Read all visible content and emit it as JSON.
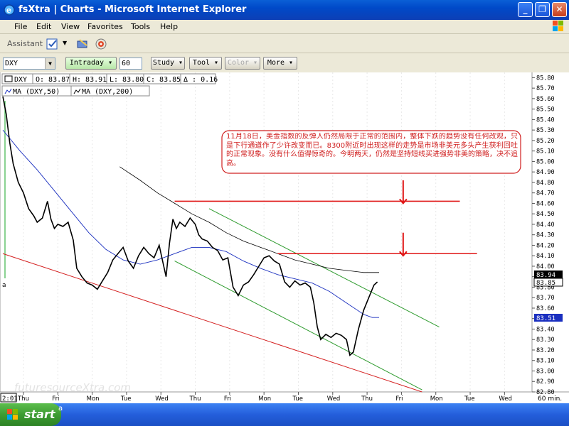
{
  "window": {
    "title": "fsXtra  |  Charts - Microsoft Internet Explorer",
    "controls": {
      "minimize": "_",
      "maximize": "❐",
      "close": "✕"
    }
  },
  "menu": [
    "File",
    "Edit",
    "View",
    "Favorites",
    "Tools",
    "Help"
  ],
  "toolbar": {
    "assistant_label": "Assistant"
  },
  "chart_toolbar": {
    "symbol": "DXY",
    "period_mode": "Intraday",
    "interval": "60",
    "buttons": [
      "Study",
      "Tool",
      "Color",
      "More"
    ]
  },
  "legend": {
    "ohlc": {
      "symbol": "DXY",
      "open": "O: 83.87",
      "high": "H: 83.91",
      "low": "L: 83.80",
      "close": "C: 83.85",
      "delta": "Δ : 0.16"
    },
    "ma50": "MA (DXY,50)",
    "ma200": "MA (DXY,200)"
  },
  "annotation": "11月18日，美金指数的反弹人仍然局限于正常的范围内，整体下跌的趋势没有任何改观，只是下行通道作了少许改变而已。8300附近时出现这样的走势是市场非美元多头产生获利回吐的正常现象。没有什么值得惊奇的。今明两天，仍然是坚持短线买进强势非美的策略，决不追高。",
  "watermark": "futuresourceXtra.com",
  "price_labels": {
    "last": "83.94",
    "current": "83.85",
    "ma": "83.51"
  },
  "time_corner_label": "2:01",
  "interval_label": "60 min.",
  "side_marker": "a",
  "bottom_marker": "a",
  "chart_data": {
    "type": "line",
    "ylim": [
      82.8,
      85.85
    ],
    "y_ticks": [
      "85.80",
      "85.70",
      "85.60",
      "85.50",
      "85.40",
      "85.30",
      "85.20",
      "85.10",
      "85.00",
      "84.90",
      "84.80",
      "84.70",
      "84.60",
      "84.50",
      "84.40",
      "84.30",
      "84.20",
      "84.10",
      "84.00",
      "83.90",
      "83.80",
      "83.70",
      "83.60",
      "83.50",
      "83.40",
      "83.30",
      "83.20",
      "83.10",
      "83.00",
      "82.90",
      "82.80"
    ],
    "x_ticks": [
      "Thu",
      "Fri",
      "Mon",
      "Tue",
      "Wed",
      "Thu",
      "Fri",
      "Mon",
      "Tue",
      "Wed",
      "Thu",
      "Fri",
      "Mon",
      "Tue",
      "Wed"
    ],
    "x_range": [
      0,
      15
    ],
    "price": [
      [
        0.0,
        85.62
      ],
      [
        0.1,
        85.45
      ],
      [
        0.2,
        85.18
      ],
      [
        0.3,
        84.98
      ],
      [
        0.45,
        84.8
      ],
      [
        0.6,
        84.7
      ],
      [
        0.75,
        84.55
      ],
      [
        0.9,
        84.48
      ],
      [
        1.0,
        84.42
      ],
      [
        1.15,
        84.46
      ],
      [
        1.3,
        84.62
      ],
      [
        1.4,
        84.45
      ],
      [
        1.5,
        84.36
      ],
      [
        1.6,
        84.4
      ],
      [
        1.75,
        84.38
      ],
      [
        1.9,
        84.42
      ],
      [
        2.05,
        84.25
      ],
      [
        2.15,
        83.98
      ],
      [
        2.3,
        83.9
      ],
      [
        2.45,
        83.84
      ],
      [
        2.6,
        83.82
      ],
      [
        2.75,
        83.78
      ],
      [
        2.9,
        83.86
      ],
      [
        3.05,
        83.94
      ],
      [
        3.2,
        84.06
      ],
      [
        3.35,
        84.12
      ],
      [
        3.5,
        84.18
      ],
      [
        3.65,
        84.05
      ],
      [
        3.8,
        83.98
      ],
      [
        3.95,
        84.1
      ],
      [
        4.1,
        84.18
      ],
      [
        4.25,
        84.12
      ],
      [
        4.4,
        84.08
      ],
      [
        4.55,
        84.2
      ],
      [
        4.65,
        84.05
      ],
      [
        4.75,
        83.9
      ],
      [
        4.85,
        84.22
      ],
      [
        4.95,
        84.45
      ],
      [
        5.05,
        84.36
      ],
      [
        5.15,
        84.42
      ],
      [
        5.3,
        84.38
      ],
      [
        5.45,
        84.46
      ],
      [
        5.6,
        84.4
      ],
      [
        5.7,
        84.3
      ],
      [
        5.8,
        84.26
      ],
      [
        5.95,
        84.24
      ],
      [
        6.1,
        84.18
      ],
      [
        6.25,
        84.15
      ],
      [
        6.4,
        84.06
      ],
      [
        6.55,
        84.08
      ],
      [
        6.7,
        83.8
      ],
      [
        6.85,
        83.72
      ],
      [
        7.0,
        83.82
      ],
      [
        7.15,
        83.85
      ],
      [
        7.3,
        83.92
      ],
      [
        7.45,
        84.0
      ],
      [
        7.6,
        84.08
      ],
      [
        7.75,
        84.1
      ],
      [
        7.9,
        84.05
      ],
      [
        8.05,
        84.02
      ],
      [
        8.2,
        83.85
      ],
      [
        8.35,
        83.8
      ],
      [
        8.5,
        83.86
      ],
      [
        8.65,
        83.82
      ],
      [
        8.8,
        83.84
      ],
      [
        8.95,
        83.8
      ],
      [
        9.05,
        83.65
      ],
      [
        9.15,
        83.42
      ],
      [
        9.25,
        83.3
      ],
      [
        9.4,
        83.35
      ],
      [
        9.55,
        83.32
      ],
      [
        9.7,
        83.36
      ],
      [
        9.85,
        83.34
      ],
      [
        10.0,
        83.3
      ],
      [
        10.1,
        83.15
      ],
      [
        10.2,
        83.18
      ],
      [
        10.35,
        83.4
      ],
      [
        10.5,
        83.58
      ],
      [
        10.65,
        83.7
      ],
      [
        10.8,
        83.82
      ],
      [
        10.9,
        83.85
      ]
    ],
    "ma50": [
      [
        0.0,
        85.3
      ],
      [
        0.5,
        85.1
      ],
      [
        1.0,
        84.92
      ],
      [
        1.5,
        84.72
      ],
      [
        2.0,
        84.52
      ],
      [
        2.5,
        84.32
      ],
      [
        3.0,
        84.16
      ],
      [
        3.5,
        84.06
      ],
      [
        4.0,
        84.02
      ],
      [
        4.5,
        84.06
      ],
      [
        5.0,
        84.12
      ],
      [
        5.5,
        84.18
      ],
      [
        6.0,
        84.18
      ],
      [
        6.5,
        84.14
      ],
      [
        7.0,
        84.05
      ],
      [
        7.5,
        83.98
      ],
      [
        8.0,
        83.92
      ],
      [
        8.5,
        83.88
      ],
      [
        9.0,
        83.84
      ],
      [
        9.5,
        83.76
      ],
      [
        10.0,
        83.65
      ],
      [
        10.5,
        83.54
      ],
      [
        10.75,
        83.51
      ],
      [
        10.95,
        83.51
      ]
    ],
    "ma200": [
      [
        3.4,
        84.95
      ],
      [
        4.0,
        84.82
      ],
      [
        4.5,
        84.7
      ],
      [
        5.0,
        84.6
      ],
      [
        5.5,
        84.5
      ],
      [
        6.0,
        84.42
      ],
      [
        6.5,
        84.32
      ],
      [
        7.0,
        84.24
      ],
      [
        7.5,
        84.18
      ],
      [
        8.0,
        84.12
      ],
      [
        8.5,
        84.06
      ],
      [
        9.0,
        84.02
      ],
      [
        9.5,
        83.98
      ],
      [
        10.0,
        83.96
      ],
      [
        10.5,
        83.94
      ],
      [
        10.95,
        83.94
      ]
    ],
    "resistance_lines": [
      {
        "x1": 5.0,
        "x2": 13.3,
        "y": 84.62
      },
      {
        "x1": 8.0,
        "x2": 13.8,
        "y": 84.12
      }
    ],
    "arrows": [
      {
        "x": 11.65,
        "y_top": 84.82,
        "y_bottom": 84.6
      },
      {
        "x": 11.65,
        "y_top": 84.32,
        "y_bottom": 84.1
      }
    ],
    "trend_channel": [
      {
        "x1": 6.0,
        "y1": 84.55,
        "x2": 12.7,
        "y2": 83.42
      },
      {
        "x1": 5.0,
        "y1": 84.05,
        "x2": 12.2,
        "y2": 82.82
      }
    ],
    "long_trendline": {
      "x1": 0.0,
      "y1": 84.12,
      "x2": 12.2,
      "y2": 82.8
    }
  }
}
